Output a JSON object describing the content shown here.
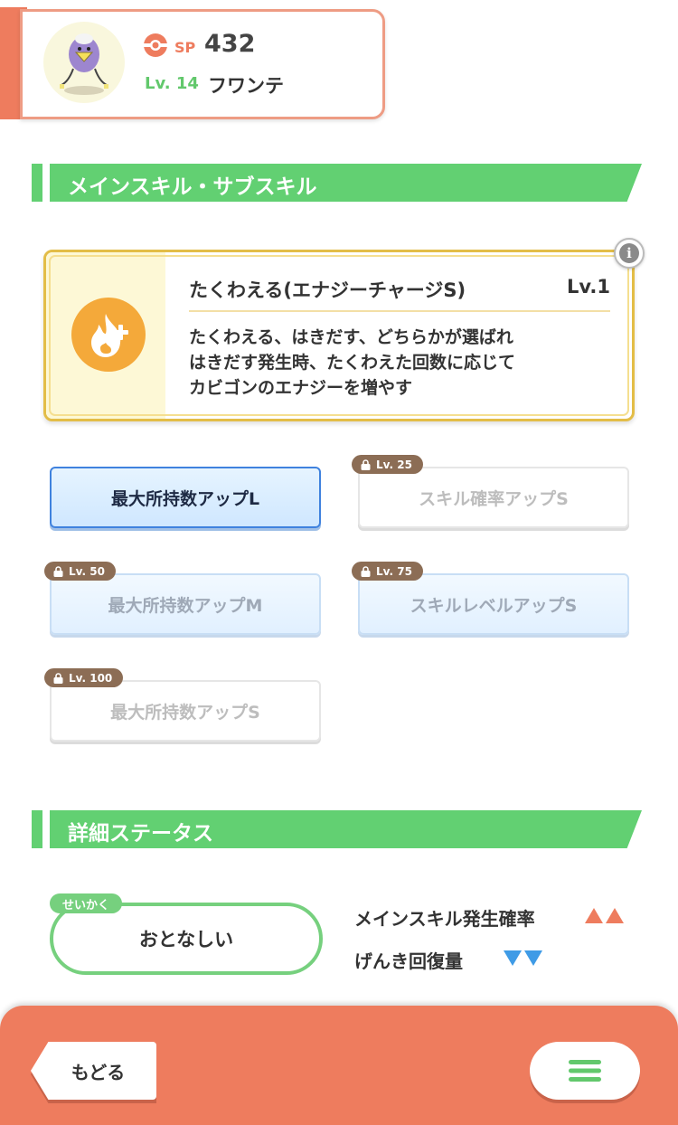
{
  "header": {
    "sp_label": "SP",
    "sp_value": "432",
    "level": "Lv. 14",
    "name": "フワンテ"
  },
  "sections": {
    "skills_title": "メインスキル・サブスキル",
    "status_title": "詳細ステータス"
  },
  "main_skill": {
    "name": "たくわえる(エナジーチャージS)",
    "level": "Lv.1",
    "description": [
      "たくわえる、はきだす、どちらかが選ばれ",
      "はきだす発生時、たくわえた回数に応じて",
      "カビゴンのエナジーを増やす"
    ],
    "icon": "flame-plus-icon",
    "info_icon": "info-icon"
  },
  "sub_skills": [
    {
      "label": "最大所持数アップL",
      "lock": ""
    },
    {
      "label": "スキル確率アップS",
      "lock": "Lv. 25"
    },
    {
      "label": "最大所持数アップM",
      "lock": "Lv. 50"
    },
    {
      "label": "スキルレベルアップS",
      "lock": "Lv. 75"
    },
    {
      "label": "最大所持数アップS",
      "lock": "Lv. 100"
    }
  ],
  "status": {
    "nature_tag": "せいかく",
    "nature": "おとなしい",
    "up_stat": "メインスキル発生確率",
    "down_stat": "げんき回復量"
  },
  "bottom": {
    "back_label": "もどる",
    "menu_icon": "hamburger-menu-icon"
  },
  "colors": {
    "accent": "#ee7c5e",
    "green": "#62d072",
    "gold": "#e3bd47",
    "blue": "#3f82de"
  }
}
